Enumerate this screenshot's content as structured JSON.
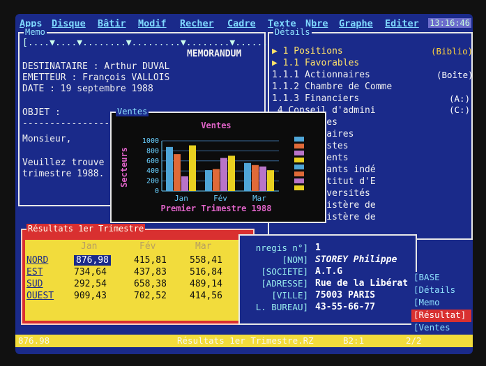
{
  "menu": {
    "items": [
      "Apps",
      "Disque",
      "Bâtir",
      "Modif",
      "Recher",
      "Cadre",
      "Texte",
      "Nbre",
      "Graphe",
      "Editer"
    ],
    "clock": "13:16:46"
  },
  "memo": {
    "title": "Memo",
    "ruler": "[....▼....▼........▼.........▼........▼.........",
    "heading": "MEMORANDUM",
    "lines": [
      "DESTINATAIRE : Arthur DUVAL",
      "EMETTEUR     : François VALLOIS",
      "DATE         : 19 septembre 1988",
      "",
      "OBJET        :",
      "----------------------",
      "Monsieur,",
      "",
      "Veuillez trouve",
      "trimestre 1988."
    ]
  },
  "details": {
    "title": "Détails",
    "lines": [
      "▶ 1  Positions",
      " ▶ 1.1  Favorables",
      "       1.1.1  Actionnaires",
      "       1.1.2  Chambre de Comme",
      "       1.1.3  Financiers",
      "          .4  Conseil d'admini",
      "        Défavorables",
      "        .1  Actionnaires",
      "        .2  Ecologistes",
      "        .3  Concurrents",
      "        .4  Consultants indé",
      "        .2.4.1  Institut d'E",
      "        .2.4.2  Universités",
      "        .2.4.3  Ministère de",
      "        .2.4.4  Ministère de"
    ],
    "side_tags": [
      "(Biblio)",
      "(Boîte)",
      "(A:)",
      "(C:)"
    ]
  },
  "ventes": {
    "window_title": "Ventes"
  },
  "chart_data": {
    "type": "bar",
    "title": "Ventes",
    "subtitle": "Premier Trimestre 1988",
    "ylabel": "Secteurs",
    "xlabel": "",
    "categories": [
      "Jan",
      "Fév",
      "Mar"
    ],
    "yticks": [
      "1000",
      "800",
      "600",
      "400",
      "200",
      "0"
    ],
    "ylim": [
      0,
      1000
    ],
    "grid": true,
    "series": [
      {
        "values": [
          876.98,
          415.81,
          558.41
        ],
        "color": "#4fa6d8"
      },
      {
        "values": [
          734.64,
          437.83,
          516.84
        ],
        "color": "#e06a38"
      },
      {
        "values": [
          292.54,
          658.38,
          489.14
        ],
        "color": "#b874c8"
      },
      {
        "values": [
          909.43,
          702.52,
          414.56
        ],
        "color": "#e8d020"
      }
    ],
    "legend_colors": [
      "#4fa6d8",
      "#e06a38",
      "#b874c8",
      "#e8d020",
      "#4fa6d8",
      "#e06a38",
      "#b874c8",
      "#e8d020"
    ]
  },
  "results": {
    "title": "Résultats 1er Trimestre",
    "months": [
      "Jan",
      "Fév",
      "Mar"
    ],
    "rows": [
      {
        "label": "NORD",
        "values": [
          "876,98",
          "415,81",
          "558,41"
        ]
      },
      {
        "label": "EST",
        "values": [
          "734,64",
          "437,83",
          "516,84"
        ]
      },
      {
        "label": "SUD",
        "values": [
          "292,54",
          "658,38",
          "489,14"
        ]
      },
      {
        "label": "OUEST",
        "values": [
          "909,43",
          "702,52",
          "414,56"
        ]
      }
    ]
  },
  "fiche": {
    "fields": [
      {
        "label": "nregis n°]",
        "value": "1"
      },
      {
        "label": "[NOM]",
        "value": "STOREY Philippe"
      },
      {
        "label": "[SOCIETE]",
        "value": "A.T.G"
      },
      {
        "label": "[ADRESSE]",
        "value": "Rue de la Libérat"
      },
      {
        "label": "[VILLE]",
        "value": "75003 PARIS"
      },
      {
        "label": "L. BUREAU]",
        "value": "43-55-66-77"
      }
    ]
  },
  "stack": {
    "items": [
      "[BASE",
      "[Détails",
      "[Memo",
      "[Résultat]",
      "[Ventes"
    ]
  },
  "status": {
    "value": "876.98",
    "doc": "Résultats 1er Trimestre.RZ",
    "cell": "B2:1",
    "page": "2/2"
  }
}
